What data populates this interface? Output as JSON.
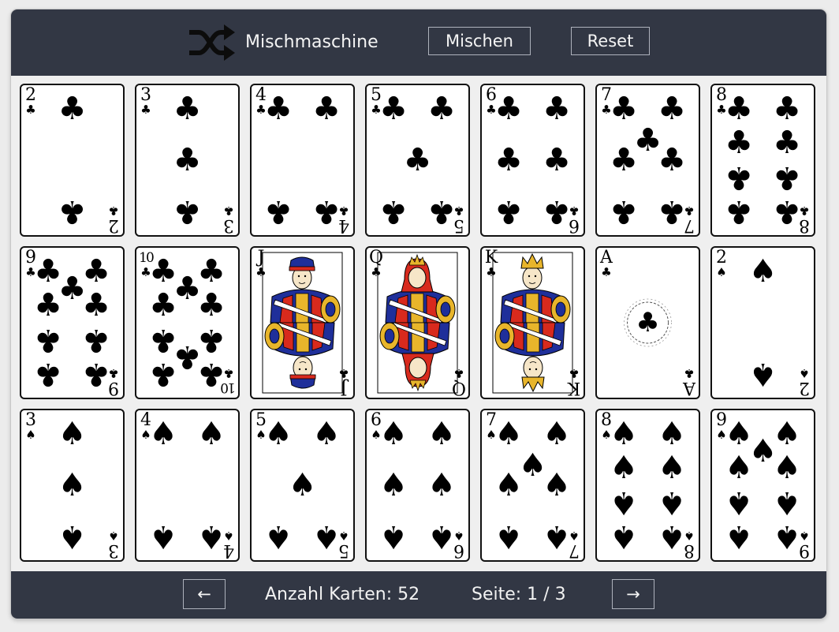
{
  "header": {
    "title": "Mischmaschine",
    "logo_icon": "shuffle-icon",
    "shuffle_label": "Mischen",
    "reset_label": "Reset"
  },
  "footer": {
    "prev_label": "←",
    "next_label": "→",
    "card_count_text": "Anzahl Karten: 52",
    "page_text": "Seite: 1 / 3"
  },
  "colors": {
    "bar": "#323744",
    "panel": "#efefef",
    "card_ink": "#000000"
  },
  "cards": [
    {
      "rank": "2",
      "suit": "clubs",
      "symbol": "♣"
    },
    {
      "rank": "3",
      "suit": "clubs",
      "symbol": "♣"
    },
    {
      "rank": "4",
      "suit": "clubs",
      "symbol": "♣"
    },
    {
      "rank": "5",
      "suit": "clubs",
      "symbol": "♣"
    },
    {
      "rank": "6",
      "suit": "clubs",
      "symbol": "♣"
    },
    {
      "rank": "7",
      "suit": "clubs",
      "symbol": "♣"
    },
    {
      "rank": "8",
      "suit": "clubs",
      "symbol": "♣"
    },
    {
      "rank": "9",
      "suit": "clubs",
      "symbol": "♣"
    },
    {
      "rank": "10",
      "suit": "clubs",
      "symbol": "♣"
    },
    {
      "rank": "J",
      "suit": "clubs",
      "symbol": "♣"
    },
    {
      "rank": "Q",
      "suit": "clubs",
      "symbol": "♣"
    },
    {
      "rank": "K",
      "suit": "clubs",
      "symbol": "♣"
    },
    {
      "rank": "A",
      "suit": "clubs",
      "symbol": "♣"
    },
    {
      "rank": "2",
      "suit": "spades",
      "symbol": "♠"
    },
    {
      "rank": "3",
      "suit": "spades",
      "symbol": "♠"
    },
    {
      "rank": "4",
      "suit": "spades",
      "symbol": "♠"
    },
    {
      "rank": "5",
      "suit": "spades",
      "symbol": "♠"
    },
    {
      "rank": "6",
      "suit": "spades",
      "symbol": "♠"
    },
    {
      "rank": "7",
      "suit": "spades",
      "symbol": "♠"
    },
    {
      "rank": "8",
      "suit": "spades",
      "symbol": "♠"
    },
    {
      "rank": "9",
      "suit": "spades",
      "symbol": "♠"
    }
  ]
}
